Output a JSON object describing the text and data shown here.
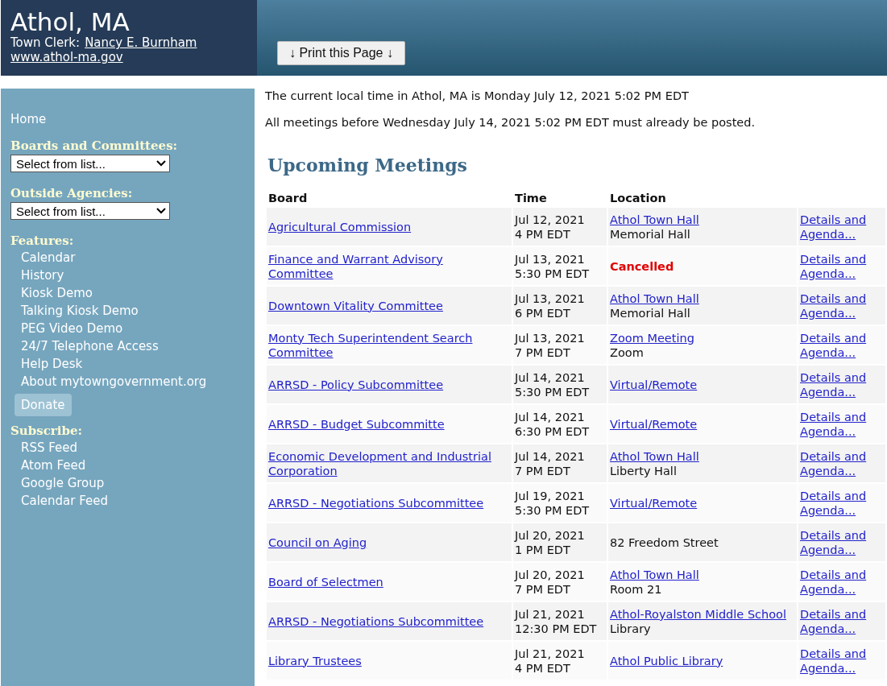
{
  "header": {
    "title": "Athol, MA",
    "clerk_label": "Town Clerk:",
    "clerk_name": "Nancy E. Burnham",
    "website": "www.athol-ma.gov",
    "print_button": "↓ Print this Page ↓"
  },
  "sidebar": {
    "home": "Home",
    "boards_label": "Boards and Committees:",
    "boards_select": "Select from list...",
    "agencies_label": "Outside Agencies:",
    "agencies_select": "Select from list...",
    "features_label": "Features:",
    "features": [
      "Calendar",
      "History",
      "Kiosk Demo",
      "Talking Kiosk Demo",
      "PEG Video Demo",
      "24/7 Telephone Access",
      "Help Desk",
      "About mytowngovernment.org"
    ],
    "donate": "Donate",
    "subscribe_label": "Subscribe:",
    "subscribe": [
      "RSS Feed",
      "Atom Feed",
      "Google Group",
      "Calendar Feed"
    ]
  },
  "notices": [
    "The current local time in Athol, MA is Monday July 12, 2021 5:02 PM EDT",
    "All meetings before Wednesday July 14, 2021 5:02 PM EDT must already be posted."
  ],
  "heading": "Upcoming Meetings",
  "table": {
    "columns": [
      "Board",
      "Time",
      "Location"
    ],
    "rows": [
      {
        "board": "Agricultural Commission",
        "date": "Jul 12, 2021",
        "time": "4 PM EDT",
        "location": [
          {
            "kind": "link",
            "text": "Athol Town Hall"
          },
          {
            "kind": "text",
            "text": "Memorial Hall"
          }
        ],
        "details": "Details and Agenda..."
      },
      {
        "board": "Finance and Warrant Advisory Committee",
        "date": "Jul 13, 2021",
        "time": "5:30 PM EDT",
        "location": [
          {
            "kind": "cancelled",
            "text": "Cancelled"
          }
        ],
        "details": "Details and Agenda..."
      },
      {
        "board": "Downtown Vitality Committee",
        "date": "Jul 13, 2021",
        "time": "6 PM EDT",
        "location": [
          {
            "kind": "link",
            "text": "Athol Town Hall"
          },
          {
            "kind": "text",
            "text": "Memorial Hall"
          }
        ],
        "details": "Details and Agenda..."
      },
      {
        "board": "Monty Tech Superintendent Search Committee",
        "date": "Jul 13, 2021",
        "time": "7 PM EDT",
        "location": [
          {
            "kind": "link",
            "text": "Zoom Meeting"
          },
          {
            "kind": "text",
            "text": "Zoom"
          }
        ],
        "details": "Details and Agenda..."
      },
      {
        "board": "ARRSD - Policy Subcommittee",
        "date": "Jul 14, 2021",
        "time": "5:30 PM EDT",
        "location": [
          {
            "kind": "link",
            "text": "Virtual/Remote"
          }
        ],
        "details": "Details and Agenda..."
      },
      {
        "board": "ARRSD - Budget Subcommitte",
        "date": "Jul 14, 2021",
        "time": "6:30 PM EDT",
        "location": [
          {
            "kind": "link",
            "text": "Virtual/Remote"
          }
        ],
        "details": "Details and Agenda..."
      },
      {
        "board": "Economic Development and Industrial Corporation",
        "date": "Jul 14, 2021",
        "time": "7 PM EDT",
        "location": [
          {
            "kind": "link",
            "text": "Athol Town Hall"
          },
          {
            "kind": "text",
            "text": "Liberty Hall"
          }
        ],
        "details": "Details and Agenda..."
      },
      {
        "board": "ARRSD - Negotiations Subcommittee",
        "date": "Jul 19, 2021",
        "time": "5:30 PM EDT",
        "location": [
          {
            "kind": "link",
            "text": "Virtual/Remote"
          }
        ],
        "details": "Details and Agenda..."
      },
      {
        "board": "Council on Aging",
        "date": "Jul 20, 2021",
        "time": "1 PM EDT",
        "location": [
          {
            "kind": "text",
            "text": "82 Freedom Street"
          }
        ],
        "details": "Details and Agenda..."
      },
      {
        "board": "Board of Selectmen",
        "date": "Jul 20, 2021",
        "time": "7 PM EDT",
        "location": [
          {
            "kind": "link",
            "text": "Athol Town Hall"
          },
          {
            "kind": "text",
            "text": "Room 21"
          }
        ],
        "details": "Details and Agenda..."
      },
      {
        "board": "ARRSD - Negotiations Subcommittee",
        "date": "Jul 21, 2021",
        "time": "12:30 PM EDT",
        "location": [
          {
            "kind": "link",
            "text": "Athol-Royalston Middle School"
          },
          {
            "kind": "text",
            "text": "Library"
          }
        ],
        "details": "Details and Agenda..."
      },
      {
        "board": "Library Trustees",
        "date": "Jul 21, 2021",
        "time": "4 PM EDT",
        "location": [
          {
            "kind": "link",
            "text": "Athol Public Library"
          }
        ],
        "details": "Details and Agenda..."
      }
    ]
  }
}
